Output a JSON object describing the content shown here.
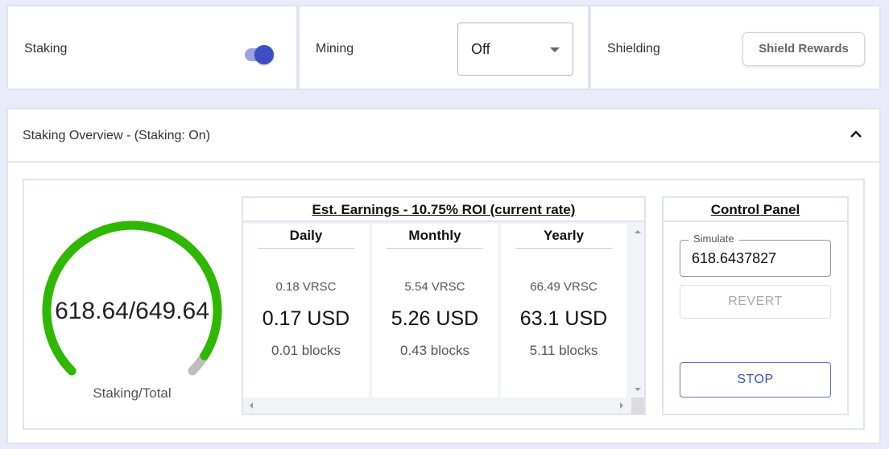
{
  "top": {
    "staking": {
      "label": "Staking",
      "enabled": true
    },
    "mining": {
      "label": "Mining",
      "value": "Off"
    },
    "shielding": {
      "label": "Shielding",
      "button": "Shield Rewards"
    }
  },
  "overview": {
    "title": "Staking Overview - (Staking: On)",
    "gauge": {
      "value_text": "618.64/649.64",
      "caption": "Staking/Total",
      "fraction": 0.952,
      "color": "#2eb800",
      "track_color": "#bdbdbd"
    },
    "earnings": {
      "title": "Est. Earnings - 10.75% ROI (current rate)",
      "columns": [
        {
          "header": "Daily",
          "vrsc": "0.18 VRSC",
          "usd": "0.17 USD",
          "blocks": "0.01 blocks"
        },
        {
          "header": "Monthly",
          "vrsc": "5.54 VRSC",
          "usd": "5.26 USD",
          "blocks": "0.43 blocks"
        },
        {
          "header": "Yearly",
          "vrsc": "66.49 VRSC",
          "usd": "63.1 USD",
          "blocks": "5.11 blocks"
        }
      ]
    },
    "control_panel": {
      "title": "Control Panel",
      "simulate_label": "Simulate",
      "simulate_value": "618.6437827",
      "revert": "REVERT",
      "stop": "STOP"
    }
  },
  "colors": {
    "accent": "#3e4dbf",
    "accent_light": "#9aa2df",
    "border": "#dfe3f2"
  }
}
